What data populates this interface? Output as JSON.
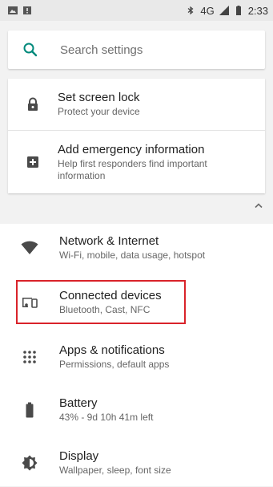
{
  "status_bar": {
    "network": "4G",
    "network_sup": "4G",
    "time": "2:33"
  },
  "search": {
    "placeholder": "Search settings"
  },
  "suggestions": [
    {
      "title": "Set screen lock",
      "subtitle": "Protect your device",
      "icon": "lock-icon"
    },
    {
      "title": "Add emergency information",
      "subtitle": "Help first responders find important information",
      "icon": "plus-box-icon"
    }
  ],
  "settings": [
    {
      "title": "Network & Internet",
      "subtitle": "Wi-Fi, mobile, data usage, hotspot",
      "icon": "wifi-icon"
    },
    {
      "title": "Connected devices",
      "subtitle": "Bluetooth, Cast, NFC",
      "icon": "devices-icon"
    },
    {
      "title": "Apps & notifications",
      "subtitle": "Permissions, default apps",
      "icon": "apps-grid-icon"
    },
    {
      "title": "Battery",
      "subtitle": "43% - 9d 10h 41m left",
      "icon": "battery-icon"
    },
    {
      "title": "Display",
      "subtitle": "Wallpaper, sleep, font size",
      "icon": "brightness-icon"
    }
  ],
  "colors": {
    "accent": "#00897b",
    "highlight": "#d9232a",
    "icon": "#5f5f5f"
  }
}
